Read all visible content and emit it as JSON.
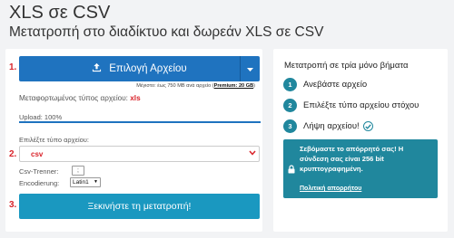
{
  "header": {
    "title": "XLS σε CSV",
    "subtitle": "Μετατροπή στο διαδίκτυο και δωρεάν XLS σε CSV"
  },
  "step_numbers": [
    "1.",
    "2.",
    "3."
  ],
  "upload": {
    "button_label": "Επιλογή Αρχείου",
    "note_prefix": "Μέγιστο: έως 750 MB ανά αρχείο (",
    "premium_link": "Premium: 20 GB",
    "note_suffix": ")",
    "filetype_label": "Μεταφορτωμένος τύπος αρχείου:",
    "filetype_value": "xls",
    "progress_label": "Upload: 100%",
    "progress_fraction": 1.0
  },
  "convert": {
    "select_label": "Επιλέξτε τύπο αρχείου:",
    "selected_format": "csv",
    "csv_trenner_label": "Csv-Trenner:",
    "csv_trenner_value": ";",
    "encoding_label": "Encodierung:",
    "encoding_value": "Latin1",
    "start_button_label": "Ξεκινήστε τη μετατροπή!"
  },
  "steps_panel": {
    "title": "Μετατροπή σε τρία μόνο βήματα",
    "steps": [
      {
        "num": "1",
        "text": "Ανεβάστε αρχείο"
      },
      {
        "num": "2",
        "text": "Επιλέξτε τύπο αρχείου στόχου"
      },
      {
        "num": "3",
        "text": "Λήψη αρχείου!"
      }
    ],
    "security_text": "Σεβόμαστε το απόρρητό σας! Η σύνδεση σας είναι 256 bit κρυπτογραφημένη.",
    "privacy_link": "Πολιτική απορρήτου"
  },
  "colors": {
    "primary_blue": "#1f73bf",
    "start_button": "#1a98c0",
    "teal": "#20879d",
    "accent_red": "#d9232a"
  }
}
